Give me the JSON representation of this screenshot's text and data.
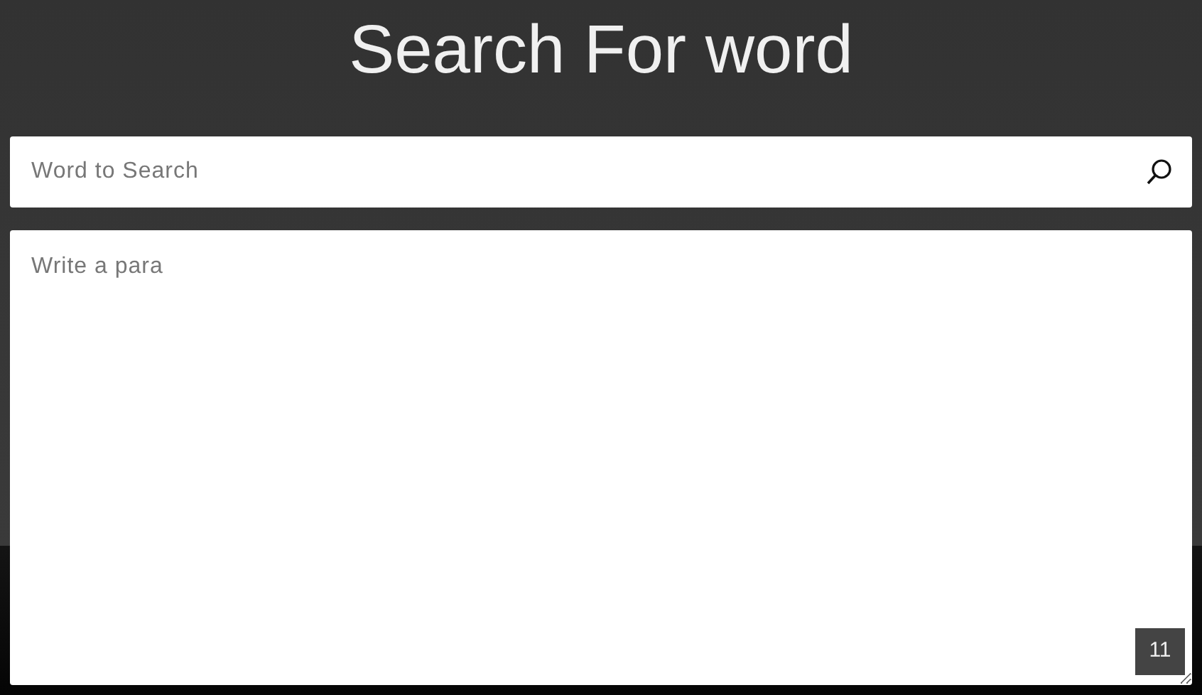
{
  "title": "Search For word",
  "search": {
    "placeholder": "Word to Search"
  },
  "paragraph": {
    "placeholder": "Write a para"
  },
  "counter": "11"
}
